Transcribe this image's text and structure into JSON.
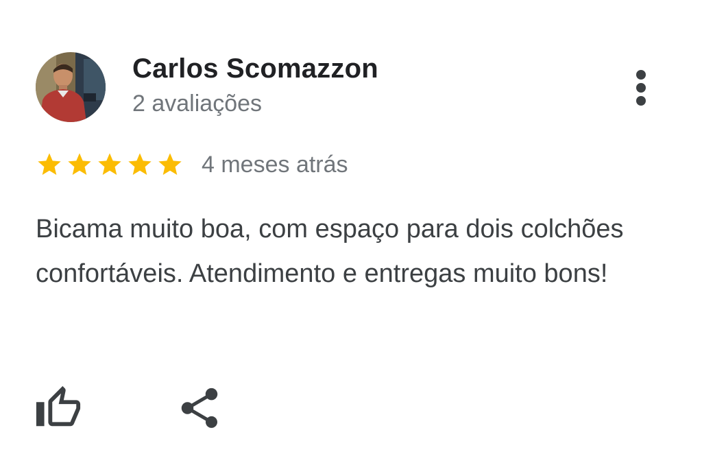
{
  "reviewer": {
    "name": "Carlos Scomazzon",
    "review_count": "2 avaliações",
    "avatar_icon": "person-photo-icon"
  },
  "rating": {
    "stars": 5,
    "max": 5,
    "star_color": "#fbbc04",
    "time_ago": "4 meses atrás"
  },
  "review": {
    "text": "Bicama muito boa, com espaço para dois colchões confortáveis. Atendimento e entregas muito bons!"
  },
  "actions": {
    "more_icon": "more-vert-icon",
    "like_icon": "thumbs-up-icon",
    "share_icon": "share-icon"
  },
  "colors": {
    "name": "#202124",
    "secondary": "#70757a",
    "body": "#3c4043",
    "icon": "#3c4043"
  }
}
